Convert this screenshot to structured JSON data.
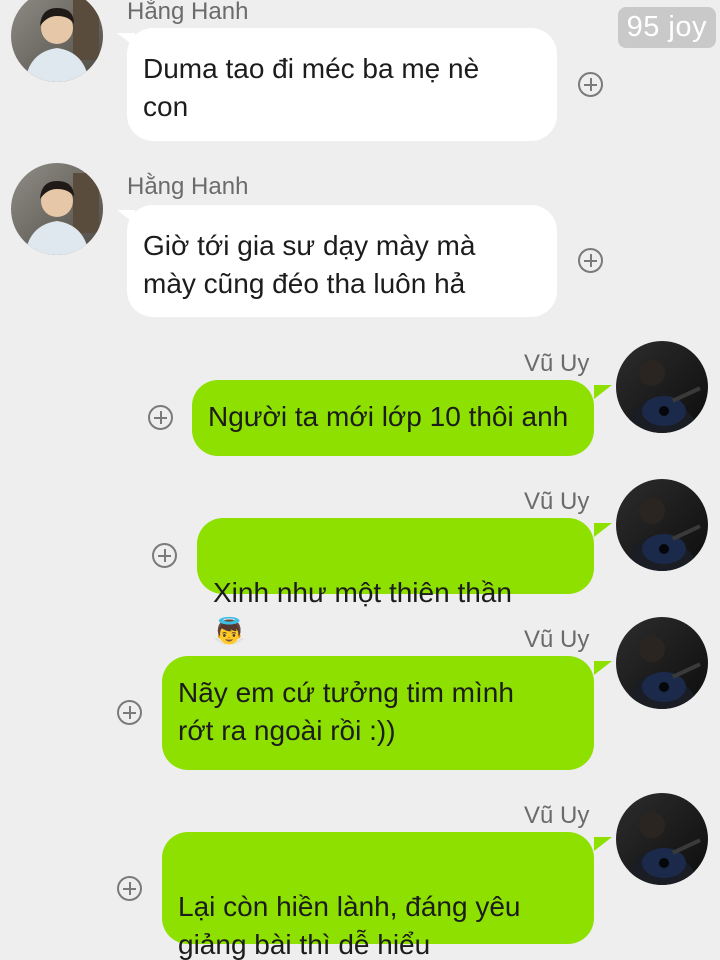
{
  "watermark": "95 joy",
  "messages": [
    {
      "sender": "Hằng Hanh",
      "text": "Duma tao đi méc ba mẹ nè\ncon"
    },
    {
      "sender": "Hằng Hanh",
      "text": "Giờ tới gia sư dạy mày mà\nmày cũng đéo tha luôn hả"
    },
    {
      "sender": "Vũ Uy",
      "text": "Người ta mới lớp 10 thôi anh"
    },
    {
      "sender": "Vũ Uy",
      "text": "Xinh như một thiên thần",
      "emoji": "👼"
    },
    {
      "sender": "Vũ Uy",
      "text": "Nãy em cứ tưởng tim mình\nrớt ra ngoài rồi :))"
    },
    {
      "sender": "Vũ Uy",
      "text": "Lại còn hiền lành, đáng yêu\ngiảng bài thì dễ hiểu",
      "emoji": "👉👉"
    }
  ],
  "colors": {
    "background": "#eeeeee",
    "incoming_bubble": "#ffffff",
    "outgoing_bubble": "#8de000",
    "sender_text": "#6b6b6b"
  },
  "icons": {
    "add_reaction": "plus-circle-icon"
  }
}
